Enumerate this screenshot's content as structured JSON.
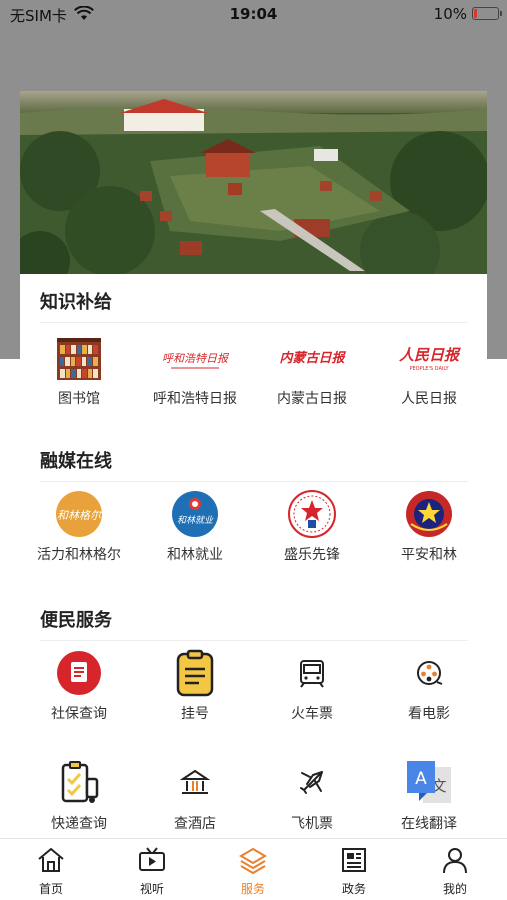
{
  "status_bar": {
    "carrier": "无SIM卡",
    "time": "19:04",
    "battery": "10%",
    "battery_level": 0.1
  },
  "sections": [
    {
      "title": "知识补给",
      "items": [
        {
          "label": "图书馆",
          "icon": "library-icon"
        },
        {
          "label": "呼和浩特日报",
          "icon": "hohhot-daily-logo"
        },
        {
          "label": "内蒙古日报",
          "icon": "inner-mongolia-daily-logo"
        },
        {
          "label": "人民日报",
          "icon": "peoples-daily-logo"
        }
      ]
    },
    {
      "title": "融媒在线",
      "items": [
        {
          "label": "活力和林格尔",
          "icon": "horinger-logo"
        },
        {
          "label": "和林就业",
          "icon": "helin-employment-logo"
        },
        {
          "label": "盛乐先锋",
          "icon": "shengle-pioneer-logo"
        },
        {
          "label": "平安和林",
          "icon": "police-badge-icon"
        }
      ]
    },
    {
      "title": "便民服务",
      "items": [
        {
          "label": "社保查询",
          "icon": "social-security-icon"
        },
        {
          "label": "挂号",
          "icon": "clipboard-icon"
        },
        {
          "label": "火车票",
          "icon": "train-icon"
        },
        {
          "label": "看电影",
          "icon": "film-reel-icon"
        },
        {
          "label": "快递查询",
          "icon": "delivery-icon"
        },
        {
          "label": "查酒店",
          "icon": "hotel-icon"
        },
        {
          "label": "飞机票",
          "icon": "airplane-icon"
        },
        {
          "label": "在线翻译",
          "icon": "translate-icon"
        }
      ]
    }
  ],
  "logo_text": {
    "hohhot_daily": "呼和浩特日报",
    "inner_mongolia_daily": "内蒙古日报",
    "peoples_daily": "人民日报",
    "peoples_daily_en": "PEOPLE'S DAILY",
    "horinger": "和林格尔",
    "helin_employment": "和林就业",
    "translate_a": "A",
    "translate_zh": "文"
  },
  "tabs": [
    {
      "label": "首页",
      "icon": "home-icon",
      "active": false
    },
    {
      "label": "视听",
      "icon": "tv-icon",
      "active": false
    },
    {
      "label": "服务",
      "icon": "layers-icon",
      "active": true
    },
    {
      "label": "政务",
      "icon": "newspaper-icon",
      "active": false
    },
    {
      "label": "我的",
      "icon": "person-icon",
      "active": false
    }
  ],
  "colors": {
    "accent": "#e8802c",
    "overlay": "#8f8f8f",
    "red_brand": "#d7262b"
  }
}
